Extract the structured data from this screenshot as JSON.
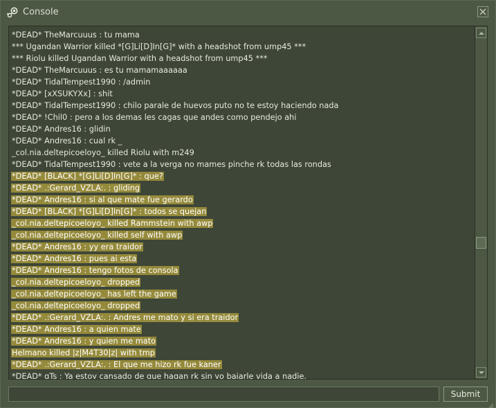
{
  "window": {
    "title": "Console"
  },
  "log": {
    "lines": [
      {
        "text": "*DEAD* TheMarcuuus : tu mama",
        "highlighted": false
      },
      {
        "text": "*** Ugandan Warrior killed *[G]Li[D]In[G]* with a headshot from ump45 ***",
        "highlighted": false
      },
      {
        "text": "*** Riolu killed Ugandan Warrior with a headshot from ump45 ***",
        "highlighted": false
      },
      {
        "text": "*DEAD* TheMarcuuus : es tu mamamaaaaaa",
        "highlighted": false
      },
      {
        "text": "*DEAD* TidalTempest1990 : /admin",
        "highlighted": false
      },
      {
        "text": "*DEAD* [xXSUKYXx] : shit",
        "highlighted": false
      },
      {
        "text": "*DEAD* TidalTempest1990 : chilo parale de huevos puto no te estoy haciendo nada",
        "highlighted": false
      },
      {
        "text": "*DEAD* !Chil0 : pero a los demas les cagas que andes como pendejo ahi",
        "highlighted": false
      },
      {
        "text": "*DEAD* Andres16 : glidin",
        "highlighted": false
      },
      {
        "text": "*DEAD* Andres16 : cual rk _",
        "highlighted": false
      },
      {
        "text": "_col.nia.deltepicoeloyo_ killed Riolu with m249",
        "highlighted": false
      },
      {
        "text": "*DEAD* TidalTempest1990 : vete a la verga no mames pinche rk todas las rondas",
        "highlighted": false
      },
      {
        "text": "*DEAD* [BLACK] *[G]Li[D]In[G]* : que?",
        "highlighted": true
      },
      {
        "text": "*DEAD* .:Gerard_VZLA:. : gliding",
        "highlighted": true
      },
      {
        "text": "*DEAD* Andres16 : si al que mate fue gerardo",
        "highlighted": true
      },
      {
        "text": "*DEAD* [BLACK] *[G]Li[D]In[G]* : todos se quejan",
        "highlighted": true
      },
      {
        "text": "_col.nia.deltepicoeloyo_ killed Rammstein with awp",
        "highlighted": true
      },
      {
        "text": "_col.nia.deltepicoeloyo_ killed self with awp",
        "highlighted": true
      },
      {
        "text": "*DEAD* Andres16 : yy era traidor",
        "highlighted": true
      },
      {
        "text": "*DEAD* Andres16 : pues ai esta",
        "highlighted": true
      },
      {
        "text": "*DEAD* Andres16 : tengo fotos de consola",
        "highlighted": true
      },
      {
        "text": "_col.nia.deltepicoeloyo_ dropped",
        "highlighted": true
      },
      {
        "text": "_col.nia.deltepicoeloyo_ has left the game",
        "highlighted": true
      },
      {
        "text": "_col.nia.deltepicoeloyo_ dropped",
        "highlighted": true
      },
      {
        "text": "*DEAD* .:Gerard_VZLA:. : Andres me mato y si era traidor",
        "highlighted": true
      },
      {
        "text": "*DEAD* Andres16 : a quien mate",
        "highlighted": true
      },
      {
        "text": "*DEAD* Andres16 : y quien me mato",
        "highlighted": true
      },
      {
        "text": "Helmano killed |z|M4T30|z| with tmp",
        "highlighted": true
      },
      {
        "text": "*DEAD* .:Gerard_VZLA:. : El que me hizo rk fue kaner",
        "highlighted": true
      },
      {
        "text": "*DEAD* gTs : Ya estoy cansado de que hagan rk sin yo bajarle vida a nadie.",
        "highlighted": false
      }
    ]
  },
  "input": {
    "value": "",
    "placeholder": ""
  },
  "submit": {
    "label": "Submit"
  },
  "colors": {
    "window_bg": "#4c5844",
    "log_bg": "#3e4637",
    "highlight": "#958a3b",
    "text": "#e6eadf"
  },
  "icons": {
    "title": "steam-icon",
    "close": "close-icon",
    "scroll_up": "arrow-up-icon",
    "scroll_down": "arrow-down-icon",
    "resize": "resize-grip-icon"
  }
}
